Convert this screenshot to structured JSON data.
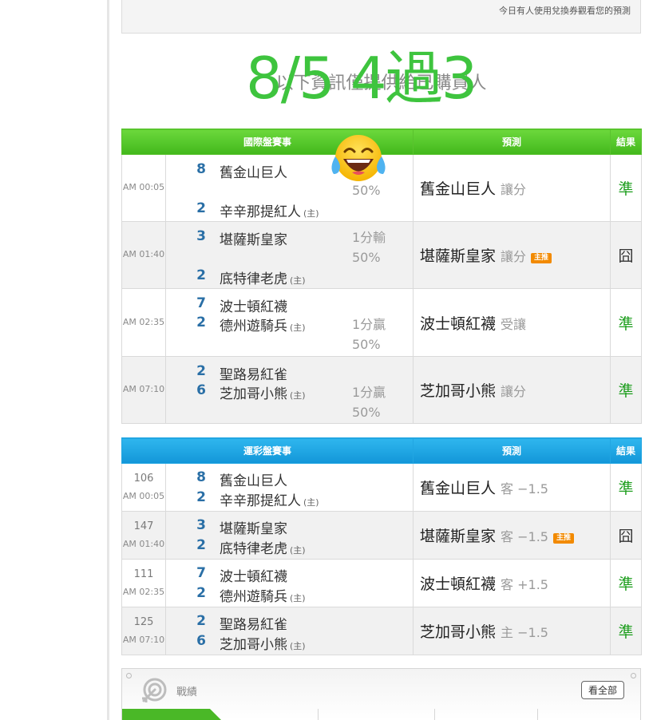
{
  "top_notice": "今日有人使用兌換券觀看您的預測",
  "buyers_heading": "以下資訊僅提供給已購買人",
  "overlay_text": "8/5 4過3",
  "intl_table": {
    "headers": {
      "event": "國際盤賽事",
      "prediction": "預測",
      "result": "結果"
    },
    "rows": [
      {
        "time": "AM 00:05",
        "score1": "8",
        "team1": "舊金山巨人",
        "score2": "2",
        "team2": "辛辛那提紅人",
        "team2_home": "(主)",
        "handicap1": "",
        "handicap2": "50%",
        "pred_team": "舊金山巨人",
        "pred_type": "讓分",
        "badge": "",
        "result": "準"
      },
      {
        "time": "AM 01:40",
        "score1": "3",
        "team1": "堪薩斯皇家",
        "score2": "2",
        "team2": "底特律老虎",
        "team2_home": "(主)",
        "handicap1": "1分輸",
        "handicap2": "50%",
        "pred_team": "堪薩斯皇家",
        "pred_type": "讓分",
        "badge": "主推",
        "result": "囧"
      },
      {
        "time": "AM 02:35",
        "score1": "7",
        "team1": "波士頓紅襪",
        "score2": "2",
        "team2": "德州遊騎兵",
        "team2_home": "(主)",
        "handicap1": "1分贏",
        "handicap2": "50%",
        "pred_team": "波士頓紅襪",
        "pred_type": "受讓",
        "badge": "",
        "result": "準"
      },
      {
        "time": "AM 07:10",
        "score1": "2",
        "team1": "聖路易紅雀",
        "score2": "6",
        "team2": "芝加哥小熊",
        "team2_home": "(主)",
        "handicap1": "1分贏",
        "handicap2": "50%",
        "pred_team": "芝加哥小熊",
        "pred_type": "讓分",
        "badge": "",
        "result": "準"
      }
    ]
  },
  "sport_table": {
    "headers": {
      "event": "運彩盤賽事",
      "prediction": "預測",
      "result": "結果"
    },
    "rows": [
      {
        "code": "106",
        "time": "AM 00:05",
        "score1": "8",
        "team1": "舊金山巨人",
        "score2": "2",
        "team2": "辛辛那提紅人",
        "team2_home": "(主)",
        "pred_team": "舊金山巨人",
        "pred_type": "客 −1.5",
        "badge": "",
        "result": "準"
      },
      {
        "code": "147",
        "time": "AM 01:40",
        "score1": "3",
        "team1": "堪薩斯皇家",
        "score2": "2",
        "team2": "底特律老虎",
        "team2_home": "(主)",
        "pred_team": "堪薩斯皇家",
        "pred_type": "客 −1.5",
        "badge": "主推",
        "result": "囧"
      },
      {
        "code": "111",
        "time": "AM 02:35",
        "score1": "7",
        "team1": "波士頓紅襪",
        "score2": "2",
        "team2": "德州遊騎兵",
        "team2_home": "(主)",
        "pred_team": "波士頓紅襪",
        "pred_type": "客 +1.5",
        "badge": "",
        "result": "準"
      },
      {
        "code": "125",
        "time": "AM 07:10",
        "score1": "2",
        "team1": "聖路易紅雀",
        "score2": "6",
        "team2": "芝加哥小熊",
        "team2_home": "(主)",
        "pred_team": "芝加哥小熊",
        "pred_type": "主 −1.5",
        "badge": "",
        "result": "準"
      }
    ]
  },
  "record_panel": {
    "title": "戰績",
    "view_all": "看全部"
  },
  "icons": {
    "emoji": "face-with-tears-of-joy-icon",
    "record": "target-icon"
  },
  "colors": {
    "intl_header": "#4ab827",
    "sport_header": "#1a9fe0",
    "hit": "#1e9e1e",
    "score": "#2a6fa6",
    "badge": "#f28a00",
    "overlay": "#3ec43e"
  }
}
